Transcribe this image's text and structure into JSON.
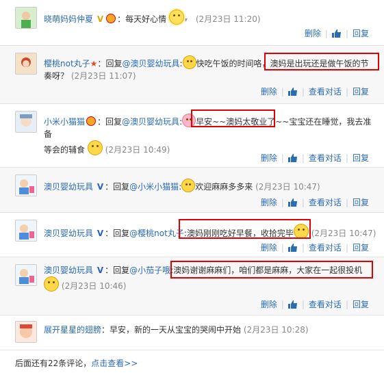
{
  "comments": [
    {
      "user": "晓萌妈妈仲夏",
      "badge": "V",
      "text": "每天好心情",
      "time": "(2月23日 11:20)",
      "actions": [
        "删除",
        "回复"
      ]
    },
    {
      "user": "樱桃not丸子",
      "reply_prefix": "回复",
      "mention": "@澳贝婴幼玩具",
      "text_a": "快吃午饭的时间咯，",
      "text_b": "澳妈是出玩还是做午饭的节",
      "text_c": "奏呀？",
      "time": "(2月23日 11:07)",
      "actions": [
        "删除",
        "查看对话",
        "回复"
      ]
    },
    {
      "user": "小米小猫猫",
      "reply_prefix": "回复",
      "mention": "@澳贝婴幼玩具",
      "text_a": "早安~~澳妈太敬业了",
      "text_b": "~~宝宝还在睡觉，我去准备",
      "text_c": "等会的辅食",
      "time": "(2月23日 10:49)",
      "actions": [
        "删除",
        "查看对话",
        "回复"
      ]
    },
    {
      "user": "澳贝婴幼玩具",
      "badge": "V",
      "reply_prefix": "回复",
      "mention": "@小米小猫猫",
      "text": "欢迎麻麻多多来",
      "time": "(2月23日 10:47)",
      "actions": [
        "删除",
        "查看对话",
        "回复"
      ]
    },
    {
      "user": "澳贝婴幼玩具",
      "badge": "V",
      "reply_prefix": "回复",
      "mention": "@樱桃not丸子",
      "text": "澳妈刚刚吃好早餐，收拾完毕",
      "time": "(2月23日 10:47)",
      "actions": [
        "删除",
        "查看对话",
        "回复"
      ]
    },
    {
      "user": "澳贝婴幼玩具",
      "badge": "V",
      "reply_prefix": "回复",
      "mention": "@小茄子哦",
      "text": "澳妈谢谢麻麻们，咱们都是麻麻，大家在一起很投机",
      "time": "(2月23日 10:46)",
      "actions": [
        "删除",
        "查看对话",
        "回复"
      ]
    },
    {
      "user": "展开星星的翅膀",
      "text": "早安，新的一天从宝宝的哭闹中开始",
      "time": "(2月23日 10:28)"
    }
  ],
  "footer": {
    "prefix": "后面还有22条评论，",
    "link": "点击查看>>"
  },
  "colors": {
    "link": "#2a6bb5",
    "highlight": "#e00000"
  }
}
